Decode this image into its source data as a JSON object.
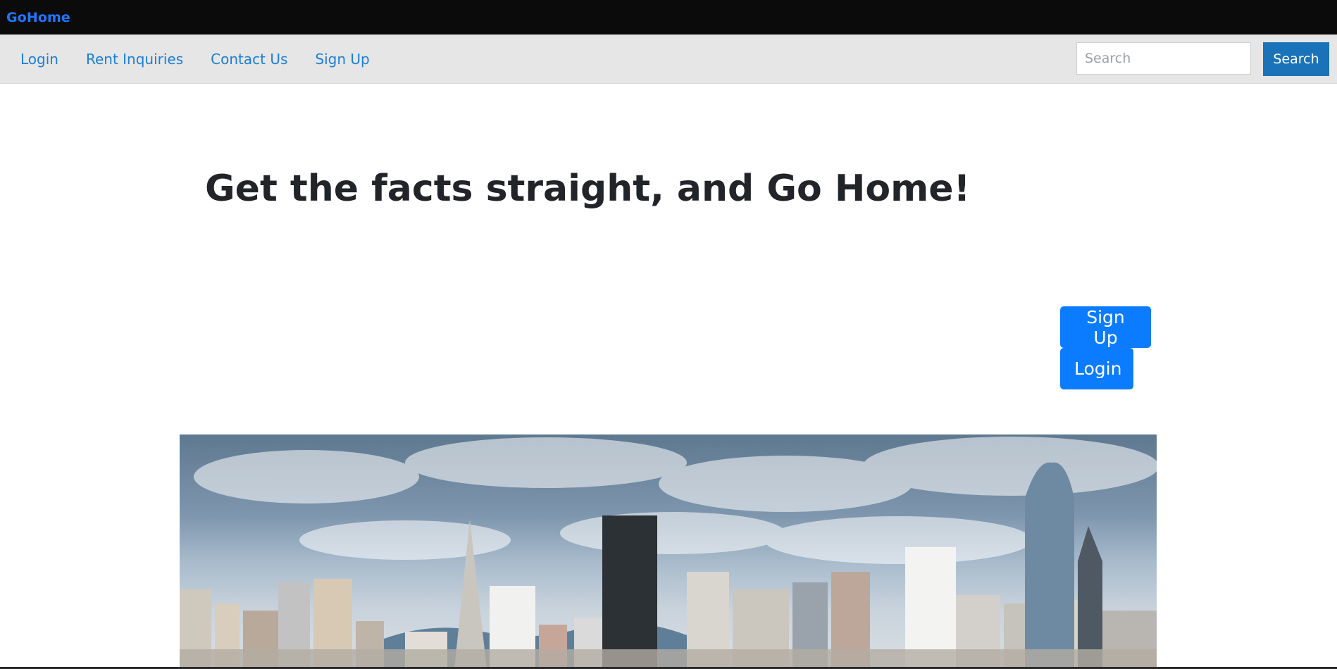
{
  "brand": "GoHome",
  "nav": {
    "links": [
      "Login",
      "Rent Inquiries",
      "Contact Us",
      "Sign Up"
    ]
  },
  "search": {
    "placeholder": "Search",
    "button_label": "Search"
  },
  "hero": {
    "title": "Get the facts straight, and Go Home!",
    "signup_label": "Sign Up",
    "login_label": "Login"
  },
  "banner": {
    "icon": "city-skyline-image"
  },
  "colors": {
    "topbar": "#0b0b0c",
    "brand": "#1f77ff",
    "nav_bg": "#e6e6e6",
    "link": "#1c7ed6",
    "search_button": "#1a73b8",
    "primary_button": "#0b7bff"
  }
}
